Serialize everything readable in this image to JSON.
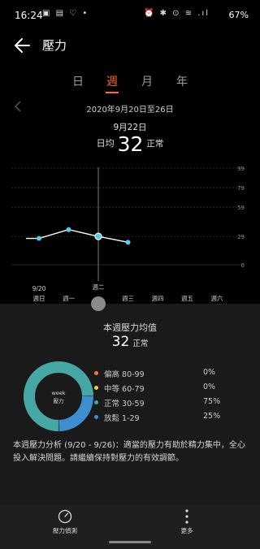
{
  "status_bar": {
    "time": "16:24",
    "left_icons": "▣ ▤ ♡ •",
    "right_icons": "⏰ ✱ ⊙ ≋ .ıl",
    "battery": "67%"
  },
  "header": {
    "title": "壓力"
  },
  "tabs": [
    {
      "label": "日",
      "active": false
    },
    {
      "label": "週",
      "active": true
    },
    {
      "label": "月",
      "active": false
    },
    {
      "label": "年",
      "active": false
    }
  ],
  "date_nav": {
    "range": "2020年9月20日至26日",
    "selected_day": "9月22日"
  },
  "summary": {
    "avg_label": "日均",
    "avg_value": "32",
    "status": "正常"
  },
  "chart_data": {
    "type": "line",
    "categories": [
      "週日",
      "週一",
      "週二",
      "週三",
      "週四",
      "週五",
      "週六"
    ],
    "first_date_label": "9/20",
    "values": [
      27,
      36,
      29,
      23,
      null,
      null,
      null
    ],
    "start_value": 27,
    "y_ticks": [
      99,
      79,
      59,
      29,
      0
    ],
    "ylim": [
      0,
      99
    ],
    "selected_index": 2,
    "colors": {
      "line": "#ffffff",
      "point": "#5bc8ee",
      "grid": "#333333"
    }
  },
  "weekly": {
    "title": "本週壓力均值",
    "value": "32",
    "status": "正常",
    "donut_label": [
      "week",
      "壓力"
    ],
    "levels": [
      {
        "label": "偏高 80-99",
        "pct": "0%",
        "value": 0,
        "color": "#f07a3a"
      },
      {
        "label": "中等 60-79",
        "pct": "0%",
        "value": 0,
        "color": "#f2c94c"
      },
      {
        "label": "正常 30-59",
        "pct": "75%",
        "value": 75,
        "color": "#46a7a5"
      },
      {
        "label": "放鬆 1-29",
        "pct": "25%",
        "value": 25,
        "color": "#3d8fcf"
      }
    ]
  },
  "analysis": "本週壓力分析 (9/20 - 9/26)：適當的壓力有助於精力集中，全心投入解決問題。請繼續保持對壓力的有效調節。",
  "bottom_nav": {
    "measure_label": "壓力偵測",
    "more_label": "更多"
  }
}
